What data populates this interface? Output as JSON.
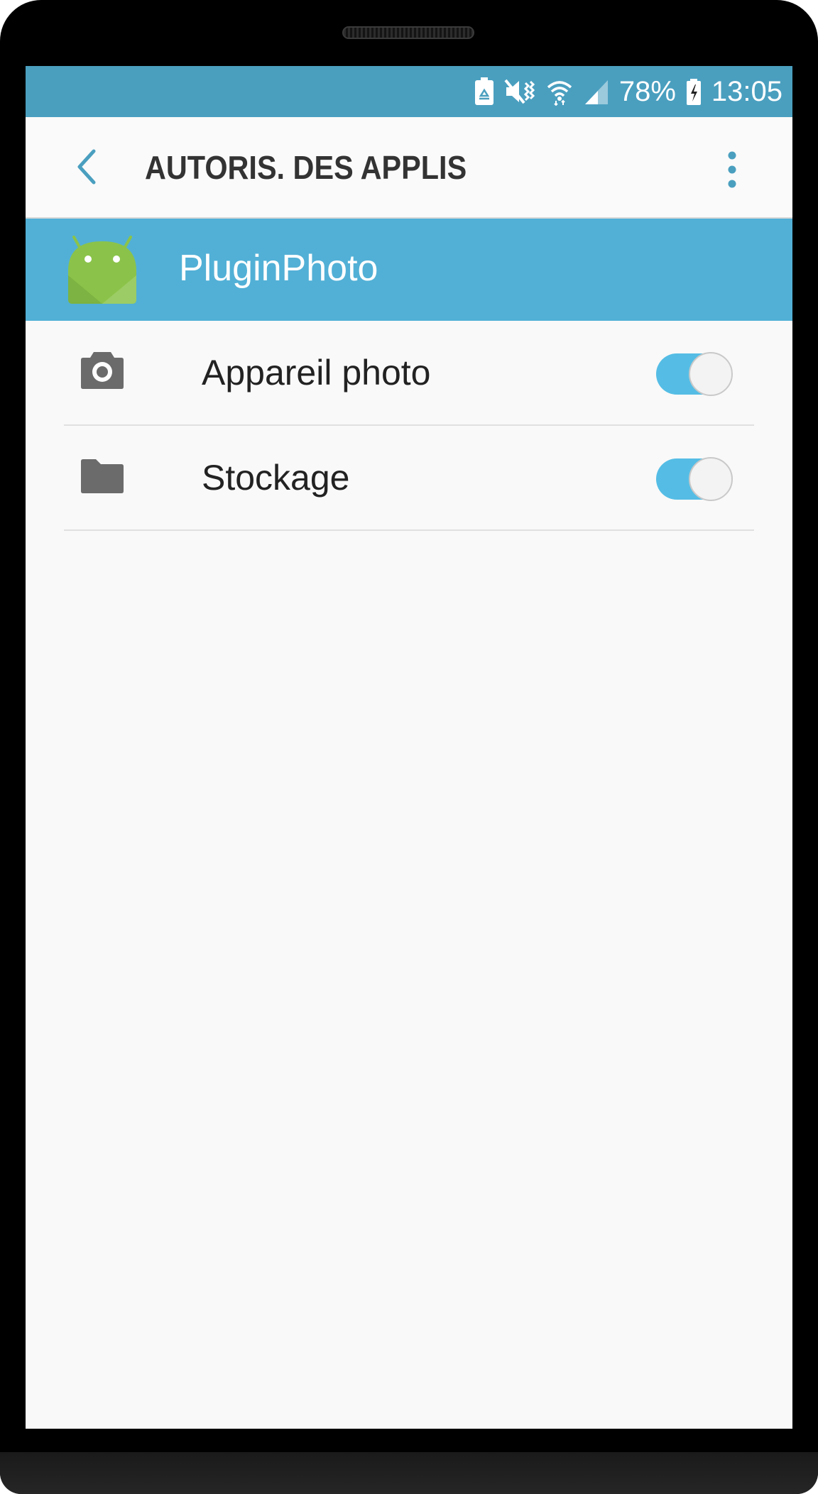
{
  "status_bar": {
    "battery_percent": "78%",
    "time": "13:05",
    "icons": [
      "battery-saver-icon",
      "vibrate-mute-icon",
      "wifi-icon",
      "signal-icon",
      "battery-charging-icon"
    ]
  },
  "toolbar": {
    "title": "AUTORIS. DES APPLIS",
    "back_icon": "chevron-left-icon",
    "more_icon": "more-vertical-icon"
  },
  "app": {
    "name": "PluginPhoto",
    "icon": "android-icon"
  },
  "permissions": [
    {
      "label": "Appareil photo",
      "icon": "camera-icon",
      "enabled": true
    },
    {
      "label": "Stockage",
      "icon": "folder-icon",
      "enabled": true
    }
  ],
  "colors": {
    "status_bar": "#4a9fbf",
    "app_header": "#52b0d6",
    "accent": "#4a9fbf",
    "toggle_on": "#55bde5",
    "background": "#f9f9f9"
  }
}
